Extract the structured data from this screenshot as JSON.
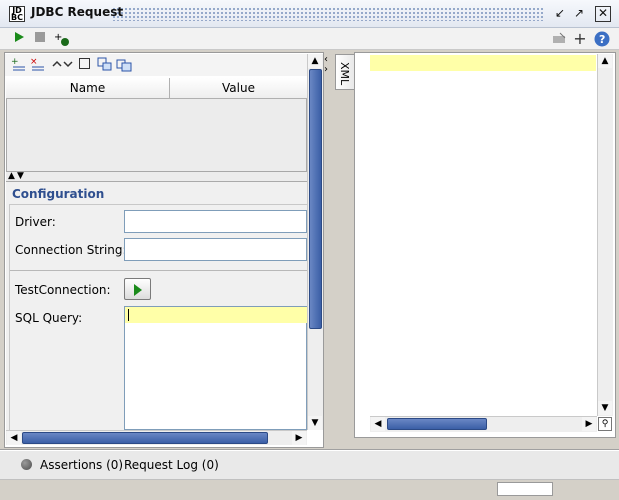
{
  "window": {
    "title": "JDBC Request"
  },
  "toolbar": {
    "run_icon": "play-icon",
    "stop_icon": "stop-icon",
    "add_icon": "add-step-icon",
    "settings_icon": "tune-icon",
    "plus_icon": "plus-icon",
    "help_icon": "help-icon"
  },
  "properties": {
    "columns": [
      "Name",
      "Value"
    ]
  },
  "config": {
    "title": "Configuration",
    "driver_label": "Driver:",
    "driver_value": "",
    "connection_label": "Connection String:",
    "connection_value": "",
    "test_label": "TestConnection:",
    "sql_label": "SQL Query:",
    "sql_value": ""
  },
  "response": {
    "tab_label": "XML",
    "content": ""
  },
  "bottom": {
    "assertions_label": "Assertions (0)",
    "request_log_label": "Request Log (0)"
  },
  "colors": {
    "accent": "#2f4f8f",
    "highlight": "#ffffa8",
    "run_green": "#1a8a1a",
    "scroll_thumb": "#3b5fa6"
  }
}
